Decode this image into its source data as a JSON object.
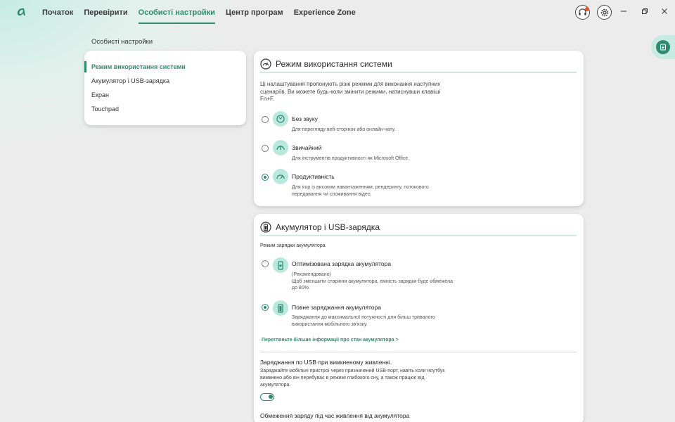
{
  "nav": {
    "items": [
      {
        "label": "Початок"
      },
      {
        "label": "Перевірити"
      },
      {
        "label": "Особисті настройки"
      },
      {
        "label": "Центр програм"
      },
      {
        "label": "Experience Zone"
      }
    ],
    "active_index": 2
  },
  "page": {
    "section_heading": "Особисті настройки"
  },
  "sidebar": {
    "items": [
      {
        "label": "Режим використання системи",
        "active": true
      },
      {
        "label": "Акумулятор і USB-зарядка"
      },
      {
        "label": "Екран"
      },
      {
        "label": "Touchpad"
      }
    ]
  },
  "usage_mode": {
    "title": "Режим використання системи",
    "description": "Ці налаштування пропонують різні режими для виконання наступних сценаріїв. Ви можете будь-коли змінити режими, натиснувши клавіші Fn+F.",
    "options": [
      {
        "label": "Без звуку",
        "sub": "Для перегляду веб-сторінок або онлайн-чату.",
        "icon": "silent-mode-icon",
        "checked": false
      },
      {
        "label": "Звичайний",
        "sub": "Для інструментів продуктивності як Microsoft Office.",
        "icon": "normal-mode-icon",
        "checked": false
      },
      {
        "label": "Продуктивність",
        "sub": "Для ігор із високим навантаженням, рендерингу, потокового передавання чи споживання відео.",
        "icon": "performance-gauge-icon",
        "checked": true
      }
    ]
  },
  "battery": {
    "title": "Акумулятор і USB-зарядка",
    "charge_mode_heading": "Режим зарядки акумулятора",
    "options": [
      {
        "label": "Оптимізована зарядка акумулятора",
        "sub": "(Рекомендовано)\nЩоб зменшити старіння акумулятора, ємність зарядки буде обмежена до 80%.",
        "icon": "battery-heart-icon",
        "checked": false
      },
      {
        "label": "Повне заряджання акумулятора",
        "sub": "Заряджання до максимальної потужності для більш тривалого використання мобільного зв'язку.",
        "icon": "battery-full-icon",
        "checked": true
      }
    ],
    "more_info_link": "Перегляньте більше інформації про стан акумулятора >",
    "usb_title": "Заряджання по USB при вимкненому живленні.",
    "usb_desc": "Заряджайте мобільні пристрої через призначений USB-порт, навіть коли ноутбук вимкнено або він перебуває в режимі глибокого сну, а також працює від акумулятора.",
    "usb_enabled": true,
    "limit_title": "Обмеження заряду під час живлення від акумулятора"
  },
  "colors": {
    "accent": "#2f8a6e",
    "icon_bg": "#b9e8dc"
  }
}
